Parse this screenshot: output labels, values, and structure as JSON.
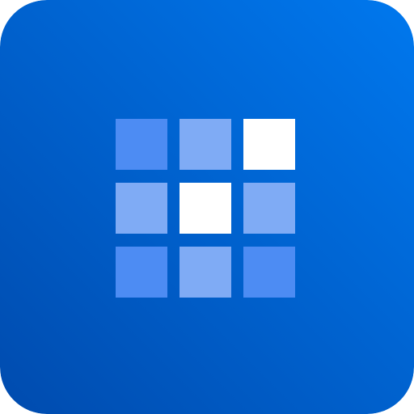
{
  "icon": {
    "name": "grid-app-icon",
    "gradient": {
      "top_right": "#0078EE",
      "bottom_left": "#004BAE"
    },
    "tiles": [
      {
        "name": "tile-1",
        "color": "#4D8CF3"
      },
      {
        "name": "tile-2",
        "color": "#7FABF5"
      },
      {
        "name": "tile-3",
        "color": "#FFFFFF"
      },
      {
        "name": "tile-4",
        "color": "#7FABF5"
      },
      {
        "name": "tile-5",
        "color": "#FFFFFF"
      },
      {
        "name": "tile-6",
        "color": "#7FABF5"
      },
      {
        "name": "tile-7",
        "color": "#4D8CF3"
      },
      {
        "name": "tile-8",
        "color": "#7FABF5"
      },
      {
        "name": "tile-9",
        "color": "#4D8CF3"
      }
    ]
  }
}
